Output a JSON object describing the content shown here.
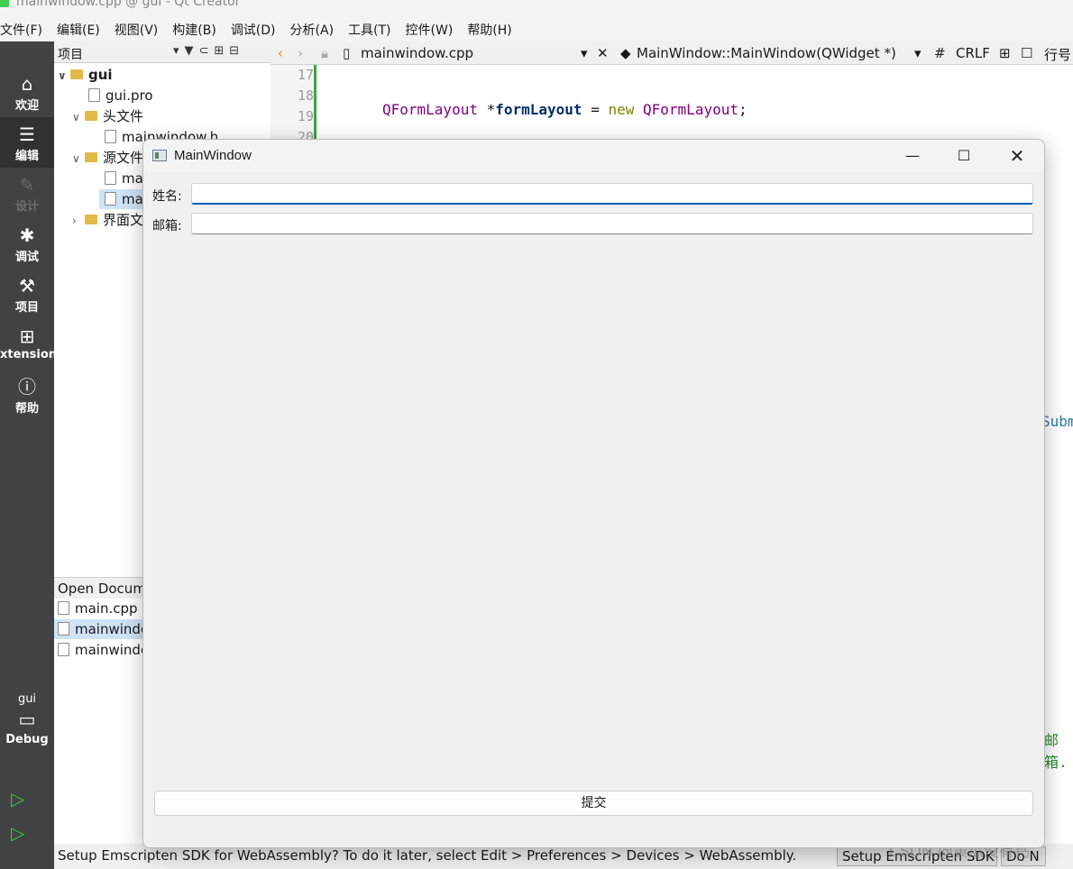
{
  "window_title": "mainwindow.cpp @ gui - Qt Creator",
  "menu": [
    "文件(F)",
    "编辑(E)",
    "视图(V)",
    "构建(B)",
    "调试(D)",
    "分析(A)",
    "工具(T)",
    "控件(W)",
    "帮助(H)"
  ],
  "modes": [
    {
      "label": "欢迎",
      "icon": "home-icon"
    },
    {
      "label": "编辑",
      "icon": "edit-icon"
    },
    {
      "label": "设计",
      "icon": "design-icon"
    },
    {
      "label": "调试",
      "icon": "debug-icon"
    },
    {
      "label": "项目",
      "icon": "wrench-icon"
    },
    {
      "label": "xtensions",
      "icon": "extensions-icon"
    },
    {
      "label": "帮助",
      "icon": "help-icon"
    }
  ],
  "kit": {
    "project": "gui",
    "build": "Debug"
  },
  "projects_panel": {
    "title": "项目",
    "tree": {
      "root": "gui",
      "pro": "gui.pro",
      "headers": "头文件",
      "header_file": "mainwindow.h",
      "sources": "源文件",
      "source1": "ma",
      "source2": "ma",
      "forms": "界面文"
    }
  },
  "open_documents": {
    "title": "Open Docum",
    "items": [
      "main.cpp",
      "mainwindo",
      "mainwindo"
    ]
  },
  "editor": {
    "tab_file": "mainwindow.cpp",
    "symbol": "MainWindow::MainWindow(QWidget *)",
    "hash": "#",
    "line_ending": "CRLF",
    "line_label": "行号",
    "line_numbers": [
      "17",
      "18",
      "19",
      "20"
    ],
    "peek_right_1": "Subm",
    "peek_right_2": "邮箱."
  },
  "status": {
    "message": "Setup Emscripten SDK for WebAssembly? To do it later, select Edit > Preferences > Devices > WebAssembly.",
    "setup_button": "Setup Emscripten SDK",
    "dont_button": "Do N"
  },
  "watermark": "CSDN @黄瓜没有钙",
  "dialog": {
    "title": "MainWindow",
    "name_label": "姓名:",
    "name_value": "",
    "email_label": "邮箱:",
    "email_value": "",
    "submit_label": "提交"
  }
}
